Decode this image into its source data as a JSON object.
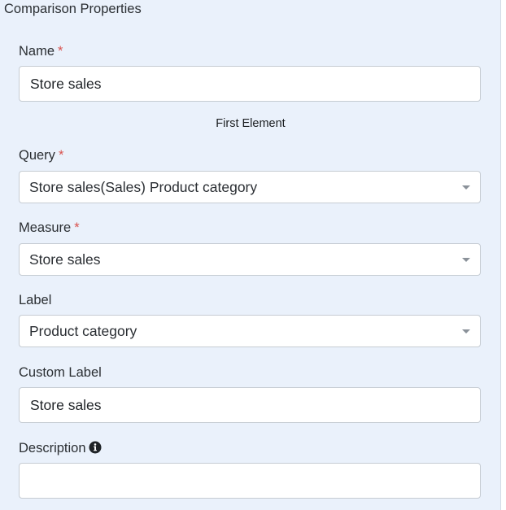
{
  "panel": {
    "title": "Comparison Properties"
  },
  "name_field": {
    "label": "Name",
    "required_mark": "*",
    "value": "Store sales"
  },
  "section": {
    "heading": "First Element"
  },
  "query_field": {
    "label": "Query",
    "required_mark": "*",
    "selected": "Store sales(Sales) Product category"
  },
  "measure_field": {
    "label": "Measure",
    "required_mark": "*",
    "selected": "Store sales"
  },
  "label_field": {
    "label": "Label",
    "selected": "Product category"
  },
  "custom_label_field": {
    "label": "Custom Label",
    "value": "Store sales"
  },
  "description_field": {
    "label": "Description",
    "icon": "info-circle-icon",
    "value": ""
  },
  "colors": {
    "panel_background": "#eaf1fb",
    "required_mark": "#d9534f",
    "input_border": "#c6ccd3"
  }
}
